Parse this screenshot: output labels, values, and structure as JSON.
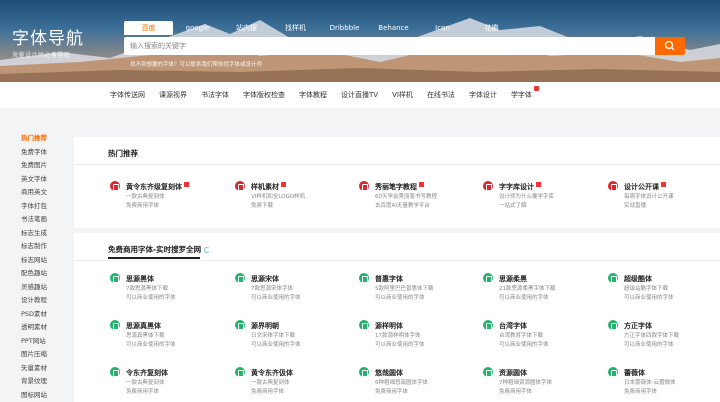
{
  "logo": {
    "title": "字体导航",
    "subtitle": "海量设计师必备导航"
  },
  "search": {
    "tabs": [
      "百度",
      "google",
      "站内搜",
      "找样机",
      "Dribbble",
      "Behance",
      "Icon",
      "花瓣"
    ],
    "placeholder": "输入搜索的关键字",
    "hint": "找不到想要的字体？可以联系我们帮你找字体或设计师"
  },
  "nav": [
    "字体传送网",
    "课源视界",
    "书法字体",
    "字体版权检查",
    "字体教程",
    "设计直播TV",
    "VI样机",
    "在线书法",
    "字体设计",
    "学字体"
  ],
  "sidebar": [
    "热门推荐",
    "免费字体",
    "免费图片",
    "英文字体",
    "商用英文",
    "字体打包",
    "书法笔画",
    "标志生成",
    "标志制作",
    "标志网站",
    "配色趣站",
    "灵感趣站",
    "设计教程",
    "PSD素材",
    "透明素材",
    "PPT网站",
    "图片压缩",
    "矢量素材",
    "背景纹理",
    "图标网站"
  ],
  "hot": {
    "title": "热门推荐",
    "items": [
      {
        "name": "黄令东齐级复刻体",
        "d1": "一款古典复刻体",
        "d2": "免费商用字体"
      },
      {
        "name": "样机素材",
        "d1": "VI样机和全LOGO样机",
        "d2": "免费下载"
      },
      {
        "name": "秀丽笔字教程",
        "d1": "60天学会秀丽笔书写教程",
        "d2": "去百度AI无量教学平台"
      },
      {
        "name": "字字库设计",
        "d1": "设计师为什么要学字库",
        "d2": "一站式了解"
      },
      {
        "name": "设计公开课",
        "d1": "每周字体设计公开课",
        "d2": "实战直播"
      }
    ]
  },
  "free": {
    "title": "免费商用字体-实时搜罗全网",
    "items": [
      {
        "name": "思源黑体",
        "d1": "7款思源黑体下载",
        "d2": "可以商业使用的字体"
      },
      {
        "name": "思源宋体",
        "d1": "7款思源宋体字体",
        "d2": "可以商业使用的字体"
      },
      {
        "name": "普惠字体",
        "d1": "5款阿里巴巴普惠体下载",
        "d2": "可以商业使用的字体"
      },
      {
        "name": "思源柔黑",
        "d1": "21款思源柔黑字体下载",
        "d2": "可以商业使用的字体"
      },
      {
        "name": "超级酷体",
        "d1": "超级站酷字体下载",
        "d2": "可以商业使用的字体"
      },
      {
        "name": "思源真黑体",
        "d1": "思源真黑体下载",
        "d2": "可以商业使用的字体"
      },
      {
        "name": "源界明朝",
        "d1": "日文宋体字体下载",
        "d2": "可以商业使用的字体"
      },
      {
        "name": "源样明体",
        "d1": "17款源样明体字体",
        "d2": "可以商业使用的字体"
      },
      {
        "name": "台湾字体",
        "d1": "台湾教育字体下载",
        "d2": "可以商业使用的字体"
      },
      {
        "name": "方正字体",
        "d1": "方正字体四款字体下载",
        "d2": "可以商业使用的字体"
      },
      {
        "name": "令东齐复刻体",
        "d1": "一款古典复刻体",
        "d2": "免费商用字体"
      },
      {
        "name": "黄令东齐伋体",
        "d1": "一款古典复刻体",
        "d2": "免费商用字体"
      },
      {
        "name": "悠哉圆体",
        "d1": "6种粗细悠哉圆体字体",
        "d2": "免费商用字体"
      },
      {
        "name": "资源圆体",
        "d1": "7种粗细资源圆体字体",
        "d2": "免费商用字体"
      },
      {
        "name": "蕾薇体",
        "d1": "日本蕾薇体-云蕾微体",
        "d2": "免费商用字体"
      }
    ]
  },
  "colors": {
    "accent": "#ff6a00",
    "red_icon": "#d9272e",
    "green_icon": "#22b46a"
  }
}
